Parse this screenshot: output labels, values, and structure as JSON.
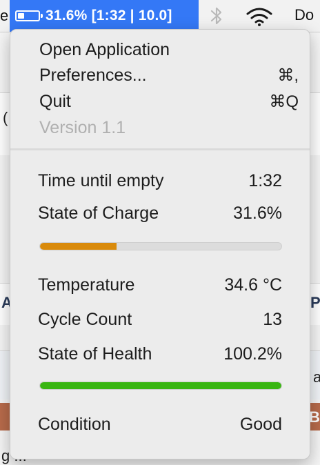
{
  "menubar": {
    "left_glyph": "e",
    "status_text": "31.6% [1:32 | 10.0]",
    "battery_level": 0.316,
    "right_text": "Do"
  },
  "background": {
    "text_a": "(",
    "text_b": "A",
    "text_c": "P",
    "text_d": "a",
    "text_e": "B",
    "text_f": "g ..."
  },
  "menu": {
    "open_application": "Open Application",
    "preferences": "Preferences...",
    "preferences_shortcut": "⌘,",
    "quit": "Quit",
    "quit_shortcut": "⌘Q",
    "version": "Version 1.1"
  },
  "battery": {
    "time_label": "Time until empty",
    "time_value": "1:32",
    "charge_label": "State of Charge",
    "charge_value": "31.6%",
    "charge_fraction": 0.316,
    "temp_label": "Temperature",
    "temp_value": "34.6 °C",
    "cycle_label": "Cycle Count",
    "cycle_value": "13",
    "health_label": "State of Health",
    "health_value": "100.2%",
    "health_fraction": 1.0,
    "condition_label": "Condition",
    "condition_value": "Good"
  },
  "colors": {
    "status_highlight": "#3478f6",
    "charge_bar": "#d98a0b",
    "health_bar": "#39b512"
  },
  "icons": {
    "battery": "battery-icon",
    "bluetooth": "bluetooth-icon",
    "wifi": "wifi-icon"
  }
}
